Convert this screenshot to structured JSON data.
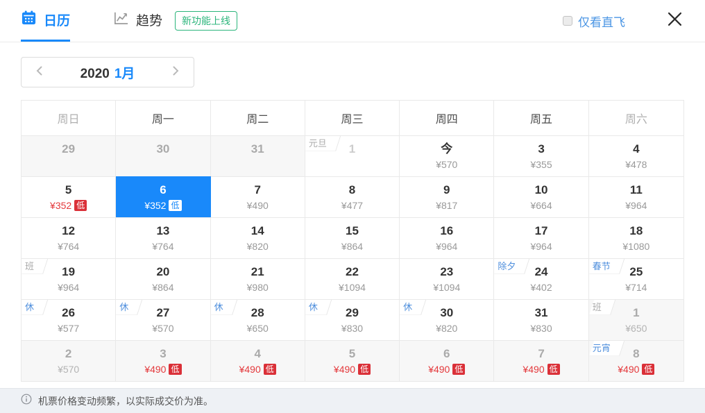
{
  "header": {
    "tabs": [
      {
        "label": "日历",
        "active": true
      },
      {
        "label": "趋势",
        "active": false
      }
    ],
    "new_feature_badge": "新功能上线",
    "direct_only_label": "仅看直飞",
    "direct_only_checked": false
  },
  "month_nav": {
    "year": "2020",
    "month": "1月"
  },
  "calendar": {
    "low_badge_label": "低",
    "weekdays": [
      {
        "label": "周日",
        "muted": true
      },
      {
        "label": "周一",
        "muted": false
      },
      {
        "label": "周二",
        "muted": false
      },
      {
        "label": "周三",
        "muted": false
      },
      {
        "label": "周四",
        "muted": false
      },
      {
        "label": "周五",
        "muted": false
      },
      {
        "label": "周六",
        "muted": true
      }
    ],
    "days": [
      {
        "day": "29",
        "variant": "other-month"
      },
      {
        "day": "30",
        "variant": "other-month"
      },
      {
        "day": "31",
        "variant": "other-month"
      },
      {
        "day": "1",
        "variant": "past",
        "tag": "元旦",
        "tag_style": "muted"
      },
      {
        "day": "今",
        "price": "¥570"
      },
      {
        "day": "3",
        "price": "¥355"
      },
      {
        "day": "4",
        "price": "¥478"
      },
      {
        "day": "5",
        "price": "¥352",
        "low": true
      },
      {
        "day": "6",
        "price": "¥352",
        "low": true,
        "selected": true
      },
      {
        "day": "7",
        "price": "¥490"
      },
      {
        "day": "8",
        "price": "¥477"
      },
      {
        "day": "9",
        "price": "¥817"
      },
      {
        "day": "10",
        "price": "¥664"
      },
      {
        "day": "11",
        "price": "¥964"
      },
      {
        "day": "12",
        "price": "¥764"
      },
      {
        "day": "13",
        "price": "¥764"
      },
      {
        "day": "14",
        "price": "¥820"
      },
      {
        "day": "15",
        "price": "¥864"
      },
      {
        "day": "16",
        "price": "¥964"
      },
      {
        "day": "17",
        "price": "¥964"
      },
      {
        "day": "18",
        "price": "¥1080"
      },
      {
        "day": "19",
        "price": "¥964",
        "tag": "班",
        "tag_style": "muted"
      },
      {
        "day": "20",
        "price": "¥864"
      },
      {
        "day": "21",
        "price": "¥980"
      },
      {
        "day": "22",
        "price": "¥1094"
      },
      {
        "day": "23",
        "price": "¥1094"
      },
      {
        "day": "24",
        "price": "¥402",
        "tag": "除夕",
        "tag_style": "blue"
      },
      {
        "day": "25",
        "price": "¥714",
        "tag": "春节",
        "tag_style": "blue"
      },
      {
        "day": "26",
        "price": "¥577",
        "tag": "休",
        "tag_style": "blue"
      },
      {
        "day": "27",
        "price": "¥570",
        "tag": "休",
        "tag_style": "blue"
      },
      {
        "day": "28",
        "price": "¥650",
        "tag": "休",
        "tag_style": "blue"
      },
      {
        "day": "29",
        "price": "¥830",
        "tag": "休",
        "tag_style": "blue"
      },
      {
        "day": "30",
        "price": "¥820",
        "tag": "休",
        "tag_style": "blue"
      },
      {
        "day": "31",
        "price": "¥830"
      },
      {
        "day": "1",
        "price": "¥650",
        "tag": "班",
        "tag_style": "muted",
        "variant": "other-month"
      },
      {
        "day": "2",
        "price": "¥570",
        "variant": "other-month"
      },
      {
        "day": "3",
        "price": "¥490",
        "low": true,
        "variant": "other-month"
      },
      {
        "day": "4",
        "price": "¥490",
        "low": true,
        "variant": "other-month"
      },
      {
        "day": "5",
        "price": "¥490",
        "low": true,
        "variant": "other-month"
      },
      {
        "day": "6",
        "price": "¥490",
        "low": true,
        "variant": "other-month"
      },
      {
        "day": "7",
        "price": "¥490",
        "low": true,
        "variant": "other-month"
      },
      {
        "day": "8",
        "price": "¥490",
        "low": true,
        "tag": "元宵",
        "tag_style": "blue",
        "variant": "other-month"
      }
    ]
  },
  "footer": {
    "notice": "机票价格变动频繁，以实际成交价为准。"
  },
  "colors": {
    "accent_blue": "#1989fa",
    "link_blue": "#4a95e4",
    "tag_blue": "#4f8fdd",
    "badge_green": "#2bb57b",
    "price_red": "#e4393c",
    "low_badge_red": "#da3038",
    "grid_border": "#e9e9e9",
    "other_month_bg": "#f7f7f7",
    "footer_bg": "#eef1f5"
  }
}
